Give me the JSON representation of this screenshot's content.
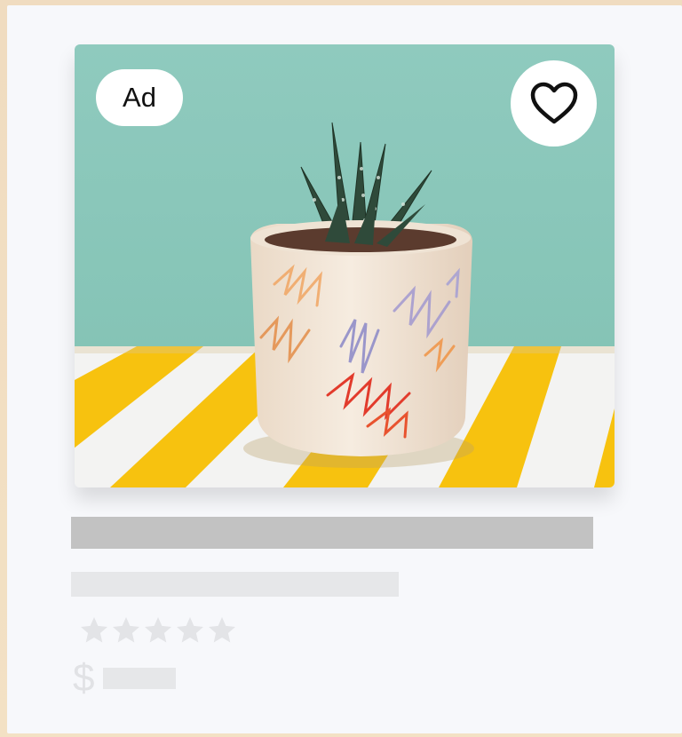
{
  "listing": {
    "ad_label": "Ad",
    "favorite_icon": "heart-icon",
    "currency_symbol": "$",
    "rating_icon": "star-icon",
    "rating_stars_shown": 5
  },
  "colors": {
    "card_background": "#f7f8fb",
    "wall": "#8ecabd",
    "stripe_yellow": "#f7c20f",
    "placeholder_dark": "#c2c2c2",
    "placeholder_light": "#e6e7e9"
  }
}
